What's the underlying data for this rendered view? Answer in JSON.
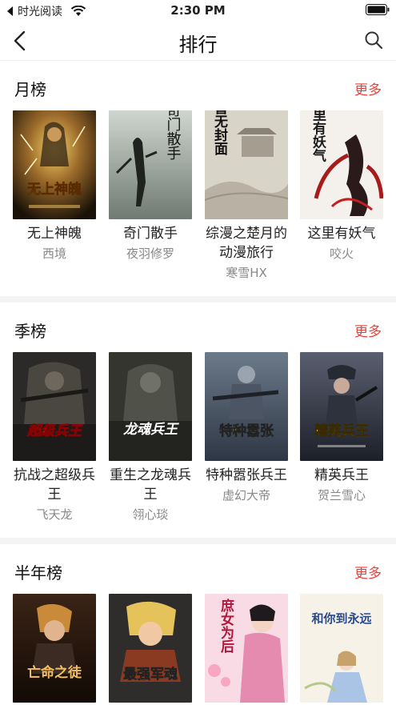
{
  "status": {
    "app_name": "时光阅读",
    "time": "2:30 PM"
  },
  "nav": {
    "title": "排行"
  },
  "sections": [
    {
      "title": "月榜",
      "more": "更多",
      "books": [
        {
          "title": "无上神魄",
          "author": "西境",
          "cover_text": "无上神魄"
        },
        {
          "title": "奇门散手",
          "author": "夜羽修罗",
          "cover_text": "奇门散手"
        },
        {
          "title": "综漫之楚月的动漫旅行",
          "author": "寒雪HX",
          "cover_text": "暂无封面"
        },
        {
          "title": "这里有妖气",
          "author": "咬火",
          "cover_text": "这里有妖气"
        }
      ]
    },
    {
      "title": "季榜",
      "more": "更多",
      "books": [
        {
          "title": "抗战之超级兵王",
          "author": "飞天龙",
          "cover_text": "超级兵王"
        },
        {
          "title": "重生之龙魂兵王",
          "author": "翎心琰",
          "cover_text": "龙魂兵王"
        },
        {
          "title": "特种嚣张兵王",
          "author": "虚幻大帝",
          "cover_text": "特种嚣张"
        },
        {
          "title": "精英兵王",
          "author": "贺兰雪心",
          "cover_text": "精英兵王"
        }
      ]
    },
    {
      "title": "半年榜",
      "more": "更多",
      "books": [
        {
          "title": "",
          "author": "",
          "cover_text": "亡命之徒"
        },
        {
          "title": "",
          "author": "",
          "cover_text": "最强军魂"
        },
        {
          "title": "",
          "author": "",
          "cover_text": "庶女为后"
        },
        {
          "title": "",
          "author": "",
          "cover_text": "和你到永远"
        }
      ]
    }
  ]
}
